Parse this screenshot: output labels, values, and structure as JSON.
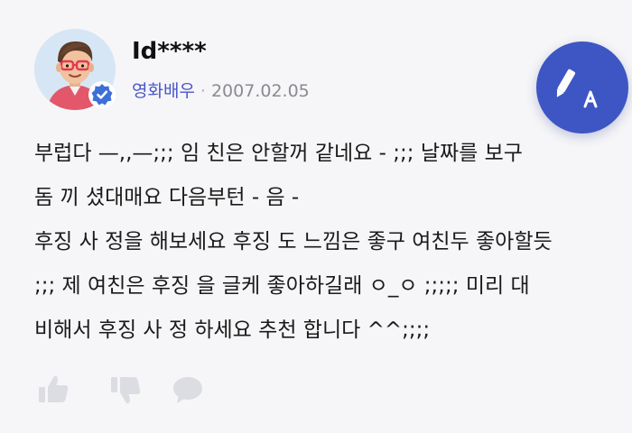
{
  "author": {
    "name": "Id****",
    "role": "영화배우",
    "separator": "·",
    "date": "2007.02.05",
    "verified": true
  },
  "answer": {
    "lines": [
      "부럽다 —,,—;;;   임 친은 안할꺼 같네요 - ;;;  날짜를 보구",
      "  돔 끼 셨대매요 다음부턴 - 음 -",
      "후징 사 정을 해보세요 후징 도 느낌은 좋구 여친두 좋아할듯",
      ";;; 제 여친은 후징 을 글케 좋아하길래 ㅇ_ㅇ ;;;;;   미리 대",
      "비해서 후징 사 정 하세요 추천 합니다 ^^;;;;"
    ]
  },
  "icons": {
    "translate": "pen-translate-icon",
    "like": "thumbs-up-icon",
    "dislike": "thumbs-down-icon",
    "comment": "comment-bubble-icon",
    "verified": "verified-check-icon"
  },
  "colors": {
    "accent": "#3d56c4",
    "role_text": "#4a57c7",
    "date_text": "#8a8a93",
    "action_icon": "#dcdde2"
  }
}
